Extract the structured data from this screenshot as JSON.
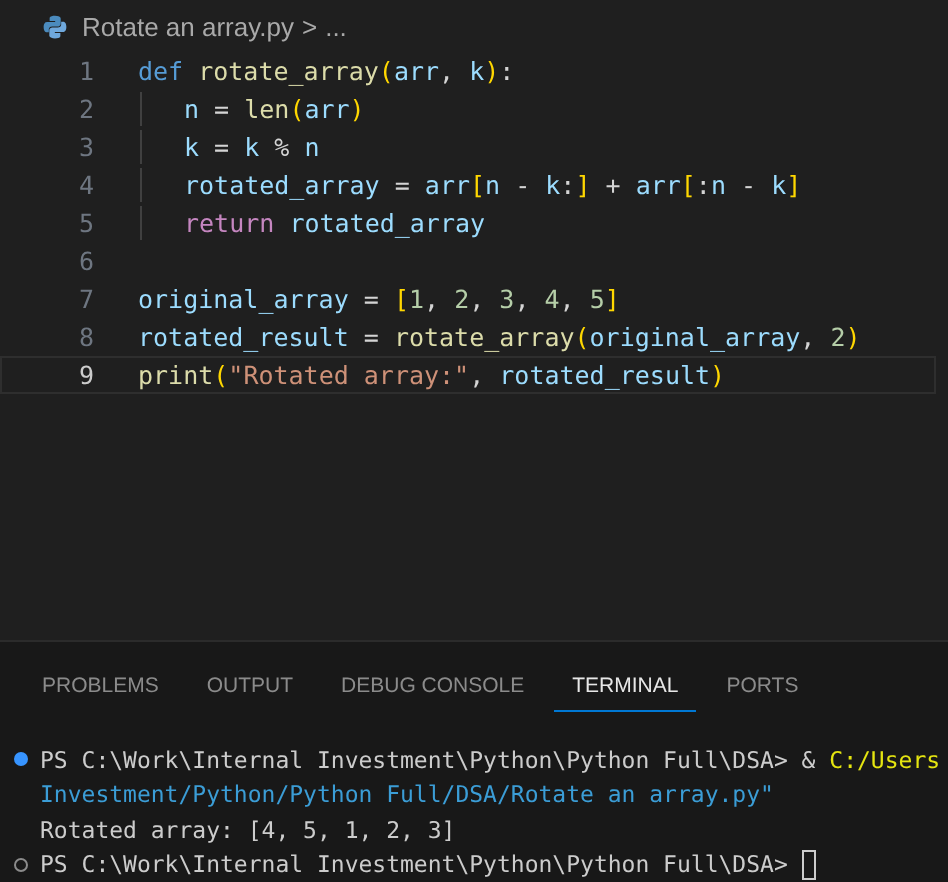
{
  "breadcrumb": {
    "file": "Rotate an array.py",
    "separator": ">",
    "more": "..."
  },
  "editor": {
    "lines": [
      {
        "number": "1",
        "current": false,
        "indented": false,
        "tokens": [
          {
            "text": "def ",
            "kind": "keyword"
          },
          {
            "text": "rotate_array",
            "kind": "func"
          },
          {
            "text": "(",
            "kind": "bracket"
          },
          {
            "text": "arr",
            "kind": "var"
          },
          {
            "text": ", ",
            "kind": "op"
          },
          {
            "text": "k",
            "kind": "var"
          },
          {
            "text": ")",
            "kind": "bracket"
          },
          {
            "text": ":",
            "kind": "op"
          }
        ]
      },
      {
        "number": "2",
        "current": false,
        "indented": true,
        "tokens": [
          {
            "text": "n",
            "kind": "var"
          },
          {
            "text": " = ",
            "kind": "op"
          },
          {
            "text": "len",
            "kind": "func"
          },
          {
            "text": "(",
            "kind": "bracket"
          },
          {
            "text": "arr",
            "kind": "var"
          },
          {
            "text": ")",
            "kind": "bracket"
          }
        ]
      },
      {
        "number": "3",
        "current": false,
        "indented": true,
        "tokens": [
          {
            "text": "k",
            "kind": "var"
          },
          {
            "text": " = ",
            "kind": "op"
          },
          {
            "text": "k",
            "kind": "var"
          },
          {
            "text": " % ",
            "kind": "op"
          },
          {
            "text": "n",
            "kind": "var"
          }
        ]
      },
      {
        "number": "4",
        "current": false,
        "indented": true,
        "tokens": [
          {
            "text": "rotated_array",
            "kind": "var"
          },
          {
            "text": " = ",
            "kind": "op"
          },
          {
            "text": "arr",
            "kind": "var"
          },
          {
            "text": "[",
            "kind": "bracket"
          },
          {
            "text": "n",
            "kind": "var"
          },
          {
            "text": " - ",
            "kind": "op"
          },
          {
            "text": "k",
            "kind": "var"
          },
          {
            "text": ":",
            "kind": "op"
          },
          {
            "text": "]",
            "kind": "bracket"
          },
          {
            "text": " + ",
            "kind": "op"
          },
          {
            "text": "arr",
            "kind": "var"
          },
          {
            "text": "[",
            "kind": "bracket"
          },
          {
            "text": ":",
            "kind": "op"
          },
          {
            "text": "n",
            "kind": "var"
          },
          {
            "text": " - ",
            "kind": "op"
          },
          {
            "text": "k",
            "kind": "var"
          },
          {
            "text": "]",
            "kind": "bracket"
          }
        ]
      },
      {
        "number": "5",
        "current": false,
        "indented": true,
        "tokens": [
          {
            "text": "return ",
            "kind": "control"
          },
          {
            "text": "rotated_array",
            "kind": "var"
          }
        ]
      },
      {
        "number": "6",
        "current": false,
        "indented": false
      },
      {
        "number": "7",
        "current": false,
        "indented": false,
        "tokens": [
          {
            "text": "original_array",
            "kind": "var"
          },
          {
            "text": " = ",
            "kind": "op"
          },
          {
            "text": "[",
            "kind": "bracket"
          },
          {
            "text": "1",
            "kind": "number"
          },
          {
            "text": ", ",
            "kind": "op"
          },
          {
            "text": "2",
            "kind": "number"
          },
          {
            "text": ", ",
            "kind": "op"
          },
          {
            "text": "3",
            "kind": "number"
          },
          {
            "text": ", ",
            "kind": "op"
          },
          {
            "text": "4",
            "kind": "number"
          },
          {
            "text": ", ",
            "kind": "op"
          },
          {
            "text": "5",
            "kind": "number"
          },
          {
            "text": "]",
            "kind": "bracket"
          }
        ]
      },
      {
        "number": "8",
        "current": false,
        "indented": false,
        "tokens": [
          {
            "text": "rotated_result",
            "kind": "var"
          },
          {
            "text": " = ",
            "kind": "op"
          },
          {
            "text": "rotate_array",
            "kind": "func"
          },
          {
            "text": "(",
            "kind": "bracket"
          },
          {
            "text": "original_array",
            "kind": "var"
          },
          {
            "text": ", ",
            "kind": "op"
          },
          {
            "text": "2",
            "kind": "number"
          },
          {
            "text": ")",
            "kind": "bracket"
          }
        ]
      },
      {
        "number": "9",
        "current": true,
        "indented": false,
        "tokens": [
          {
            "text": "print",
            "kind": "func"
          },
          {
            "text": "(",
            "kind": "bracket"
          },
          {
            "text": "\"Rotated array:\"",
            "kind": "string"
          },
          {
            "text": ", ",
            "kind": "op"
          },
          {
            "text": "rotated_result",
            "kind": "var"
          },
          {
            "text": ")",
            "kind": "bracket"
          }
        ]
      }
    ]
  },
  "panel": {
    "tabs": [
      {
        "label": "PROBLEMS",
        "selected": false
      },
      {
        "label": "OUTPUT",
        "selected": false
      },
      {
        "label": "DEBUG CONSOLE",
        "selected": false
      },
      {
        "label": "TERMINAL",
        "selected": true
      },
      {
        "label": "PORTS",
        "selected": false
      }
    ],
    "terminal": [
      {
        "kind": "success",
        "segments": [
          {
            "text": "PS C:\\Work\\Internal Investment\\Python\\Python Full\\DSA> & ",
            "kind": "plain"
          },
          {
            "text": "C:/Users",
            "kind": "path"
          }
        ]
      },
      {
        "kind": "output",
        "segments": [
          {
            "text": "Investment/Python/Python Full/DSA/Rotate an array.py\"",
            "kind": "arg"
          }
        ]
      },
      {
        "kind": "output",
        "segments": [
          {
            "text": "Rotated array: [4, 5, 1, 2, 3]",
            "kind": "plain"
          }
        ]
      },
      {
        "kind": "prompt",
        "cursor": true,
        "segments": [
          {
            "text": "PS C:\\Work\\Internal Investment\\Python\\Python Full\\DSA> ",
            "kind": "plain"
          }
        ]
      }
    ]
  }
}
